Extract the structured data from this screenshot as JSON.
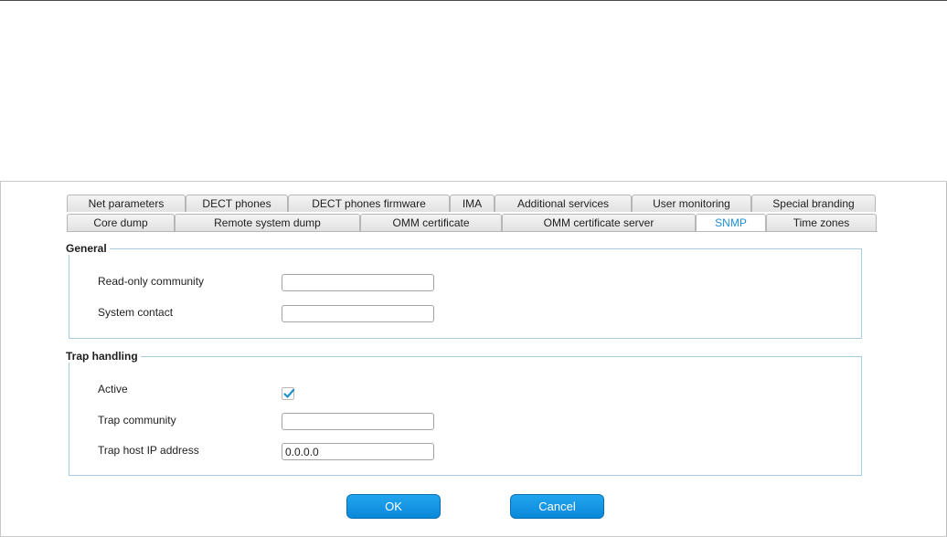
{
  "tabs": {
    "row1": [
      {
        "label": "Net parameters"
      },
      {
        "label": "DECT phones"
      },
      {
        "label": "DECT phones firmware"
      },
      {
        "label": "IMA"
      },
      {
        "label": "Additional services"
      },
      {
        "label": "User monitoring"
      },
      {
        "label": "Special branding"
      }
    ],
    "row2": [
      {
        "label": "Core dump"
      },
      {
        "label": "Remote system dump"
      },
      {
        "label": "OMM certificate"
      },
      {
        "label": "OMM certificate server"
      },
      {
        "label": "SNMP",
        "active": true
      },
      {
        "label": "Time zones"
      }
    ]
  },
  "general": {
    "legend": "General",
    "read_only_community": {
      "label": "Read-only community",
      "value": ""
    },
    "system_contact": {
      "label": "System contact",
      "value": ""
    }
  },
  "trap": {
    "legend": "Trap handling",
    "active": {
      "label": "Active",
      "checked": true
    },
    "trap_community": {
      "label": "Trap community",
      "value": ""
    },
    "trap_host": {
      "label": "Trap host IP address",
      "value": "0.0.0.0"
    }
  },
  "buttons": {
    "ok": "OK",
    "cancel": "Cancel"
  },
  "colors": {
    "accent": "#1e8fd0",
    "button": "#0a88d9",
    "fieldset_border": "#a7cbe0"
  }
}
